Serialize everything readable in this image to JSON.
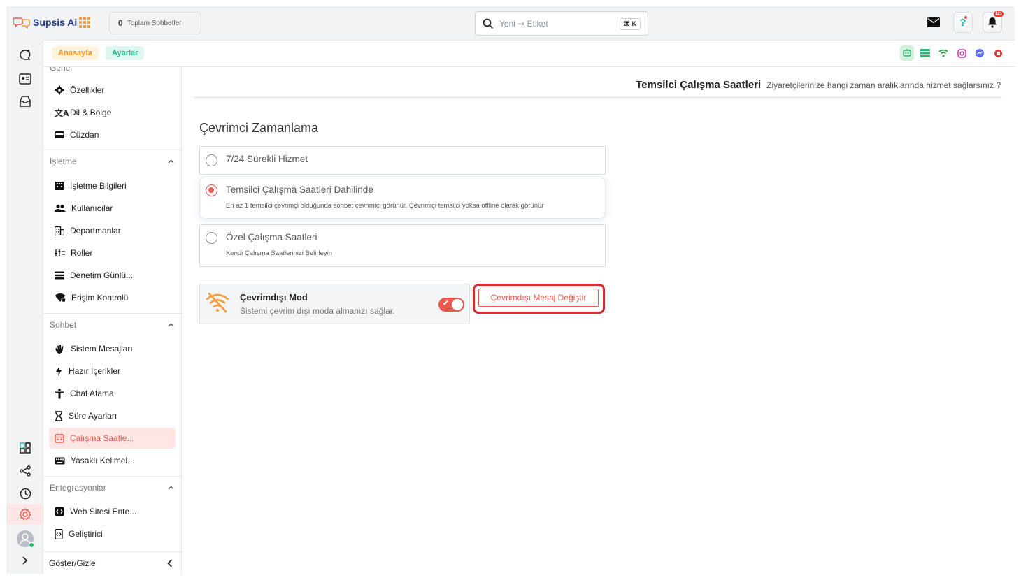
{
  "app": {
    "name": "Supsis Ai"
  },
  "topbar": {
    "conversation_count": "0",
    "conversation_label": "Toplam Sohbetler",
    "search_placeholder": "Yeni ⇥ Etiket",
    "search_shortcut": "⌘ K",
    "notification_count": "121"
  },
  "breadcrumbs": {
    "home": "Anasayfa",
    "settings": "Ayarlar"
  },
  "sidebar": {
    "cut_section": "Genel",
    "general_items": [
      {
        "label": "Özellikler",
        "icon": "gear-icon"
      },
      {
        "label": "Dil & Bölge",
        "icon": "translate-icon"
      },
      {
        "label": "Cüzdan",
        "icon": "wallet-icon"
      }
    ],
    "business_title": "İşletme",
    "business_items": [
      {
        "label": "İşletme Bilgileri",
        "icon": "building-icon"
      },
      {
        "label": "Kullanıcılar",
        "icon": "users-icon"
      },
      {
        "label": "Departmanlar",
        "icon": "department-icon"
      },
      {
        "label": "Roller",
        "icon": "roles-icon"
      },
      {
        "label": "Denetim Günlü...",
        "icon": "list-icon"
      },
      {
        "label": "Erişim Kontrolü",
        "icon": "wifi-lock-icon"
      }
    ],
    "chat_title": "Sohbet",
    "chat_items": [
      {
        "label": "Sistem Mesajları",
        "icon": "wave-icon"
      },
      {
        "label": "Hazır İçerikler",
        "icon": "bolt-icon"
      },
      {
        "label": "Chat Atama",
        "icon": "person-icon"
      },
      {
        "label": "Süre Ayarları",
        "icon": "hourglass-icon"
      },
      {
        "label": "Çalışma Saatle...",
        "icon": "calendar-icon"
      },
      {
        "label": "Yasaklı Kelimel...",
        "icon": "keyboard-icon"
      }
    ],
    "integrations_title": "Entegrasyonlar",
    "integration_items": [
      {
        "label": "Web Sitesi Ente...",
        "icon": "code-icon"
      },
      {
        "label": "Geliştirici",
        "icon": "developer-icon"
      }
    ],
    "footer_label": "Göster/Gizle"
  },
  "page": {
    "title": "Temsilci Çalışma Saatleri",
    "subtitle": "Ziyaretçilerinize hangi zaman aralıklarında hizmet sağlarsınız ?",
    "section_title": "Çevrimci Zamanlama",
    "options": [
      {
        "label": "7/24 Sürekli Hizmet",
        "desc": "",
        "selected": false
      },
      {
        "label": "Temsilci Çalışma Saatleri Dahilinde",
        "desc": "En az 1 temsilci çevrimçi olduğunda sohbet çevrimiçi görünür. Çevrimiçi temsilci yoksa offline olarak görünür",
        "selected": true
      },
      {
        "label": "Özel Çalışma Saatleri",
        "desc": "Kendi Çalışma Saatlerinizi Belirleyin",
        "selected": false
      }
    ],
    "offline_mode": {
      "title": "Çevrimdışı Mod",
      "desc": "Sistemi çevrim dışı moda almanızı sağlar.",
      "enabled": true,
      "button_label": "Çevrimdışı Mesaj Değiştir"
    }
  },
  "colors": {
    "accent": "#e85a4f",
    "highlight": "#d32f2f",
    "brand": "#1f3b8a"
  }
}
